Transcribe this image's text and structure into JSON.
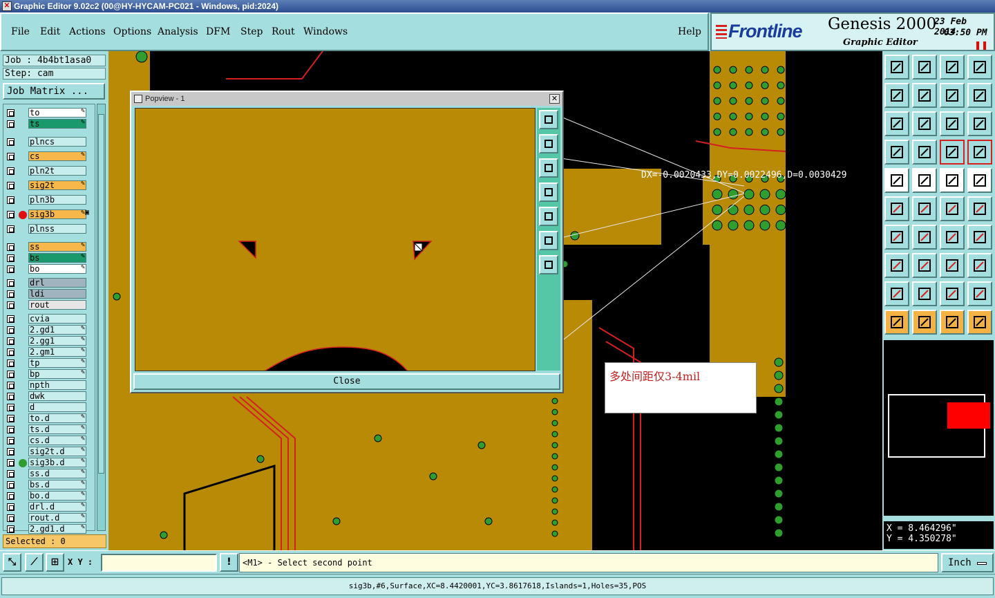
{
  "window": {
    "title": "Graphic Editor 9.02c2 (00@HY-HYCAM-PC021 - Windows, pid:2024)"
  },
  "menu": {
    "items": [
      "File",
      "Edit",
      "Actions",
      "Options",
      "Analysis",
      "DFM",
      "Step",
      "Rout",
      "Windows"
    ],
    "help": "Help"
  },
  "brand": {
    "logo": "Frontline",
    "product": "Genesis 2000",
    "subtitle": "Graphic Editor",
    "date": "23 Feb 2014",
    "time": "03:50 PM"
  },
  "job": {
    "job_line": "Job : 4b4bt1asa0",
    "step_line": "Step: cam",
    "matrix_button": "Job Matrix ..."
  },
  "layers": [
    {
      "name": "to",
      "color": "#ffffff",
      "flag": "✎"
    },
    {
      "name": "ts",
      "color": "#1a9a6c",
      "flag": "✎"
    },
    {
      "name": "plncs",
      "color": "#c7eded",
      "flag": ""
    },
    {
      "name": "cs",
      "color": "#f6b84a",
      "flag": "✎"
    },
    {
      "name": "pln2t",
      "color": "#c7eded",
      "flag": ""
    },
    {
      "name": "sig2t",
      "color": "#f6b84a",
      "flag": "✎"
    },
    {
      "name": "pln3b",
      "color": "#c7eded",
      "flag": ""
    },
    {
      "name": "sig3b",
      "color": "#f6b84a",
      "flag": "✎▣",
      "dot": "#e01010"
    },
    {
      "name": "plnss",
      "color": "#c7eded",
      "flag": ""
    },
    {
      "name": "ss",
      "color": "#f6b84a",
      "flag": "✎"
    },
    {
      "name": "bs",
      "color": "#1a9a6c",
      "flag": "✎"
    },
    {
      "name": "bo",
      "color": "#ffffff",
      "flag": "✎"
    },
    {
      "name": "drl",
      "color": "#9fb4bf",
      "flag": ""
    },
    {
      "name": "ldi",
      "color": "#9fb4bf",
      "flag": ""
    },
    {
      "name": "rout",
      "color": "#e6e6e6",
      "flag": ""
    },
    {
      "name": "cvia",
      "color": "#c7eded",
      "flag": ""
    },
    {
      "name": "2.gd1",
      "color": "#c7eded",
      "flag": "✎"
    },
    {
      "name": "2.gg1",
      "color": "#c7eded",
      "flag": "✎"
    },
    {
      "name": "2.gm1",
      "color": "#c7eded",
      "flag": "✎"
    },
    {
      "name": "tp",
      "color": "#c7eded",
      "flag": "✎"
    },
    {
      "name": "bp",
      "color": "#c7eded",
      "flag": "✎"
    },
    {
      "name": "npth",
      "color": "#c7eded",
      "flag": ""
    },
    {
      "name": "dwk",
      "color": "#c7eded",
      "flag": ""
    },
    {
      "name": "d",
      "color": "#c7eded",
      "flag": ""
    },
    {
      "name": "to.d",
      "color": "#c7eded",
      "flag": "✎"
    },
    {
      "name": "ts.d",
      "color": "#c7eded",
      "flag": "✎"
    },
    {
      "name": "cs.d",
      "color": "#c7eded",
      "flag": "✎"
    },
    {
      "name": "sig2t.d",
      "color": "#c7eded",
      "flag": "✎"
    },
    {
      "name": "sig3b.d",
      "color": "#c7eded",
      "flag": "✎",
      "dot": "#2e9c2e"
    },
    {
      "name": "ss.d",
      "color": "#c7eded",
      "flag": "✎"
    },
    {
      "name": "bs.d",
      "color": "#c7eded",
      "flag": "✎"
    },
    {
      "name": "bo.d",
      "color": "#c7eded",
      "flag": "✎"
    },
    {
      "name": "drl.d",
      "color": "#c7eded",
      "flag": "✎"
    },
    {
      "name": "rout.d",
      "color": "#c7eded",
      "flag": "✎"
    },
    {
      "name": "2.gd1.d",
      "color": "#c7eded",
      "flag": "✎"
    }
  ],
  "selected_text": "Selected : 0",
  "popview": {
    "title": "Popview - 1",
    "close_label": "Close"
  },
  "measure_text": "DX=-0.0020433,DY=0.0022496,D=0.0030429",
  "annotation": "多处间距仅3-4mil",
  "coords": {
    "x": "X = 8.464296\"",
    "y": "Y = 4.350278\""
  },
  "bottom": {
    "xy_label": "X Y :",
    "prompt": "<M1> - Select second point",
    "units": "Inch"
  },
  "status": "sig3b,#6,Surface,XC=8.4420001,YC=3.8617618,Islands=1,Holes=35,POS",
  "colors": {
    "copper": "#b98a06",
    "via": "#2f9e2f",
    "outline": "#d32020",
    "board_bg": "#000000"
  }
}
